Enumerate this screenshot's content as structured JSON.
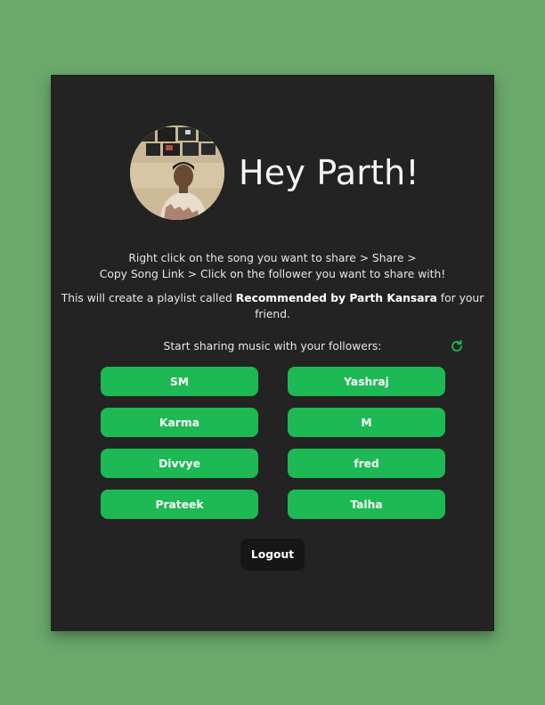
{
  "greeting": "Hey Parth!",
  "avatar_alt": "Profile photo",
  "instructions": {
    "line1a": "Right click on the song you want to share > Share >",
    "line1b": "Copy Song Link > Click on the follower you want to share with!",
    "line2_prefix": "This will create a playlist called ",
    "playlist_name": "Recommended by Parth Kansara",
    "line2_suffix": " for your friend."
  },
  "followers_heading": "Start sharing music with your followers:",
  "followers": [
    {
      "label": "SM"
    },
    {
      "label": "Yashraj"
    },
    {
      "label": "Karma"
    },
    {
      "label": "M"
    },
    {
      "label": "Divvye"
    },
    {
      "label": "fred"
    },
    {
      "label": "Prateek"
    },
    {
      "label": "Talha"
    }
  ],
  "logout_label": "Logout",
  "icons": {
    "refresh": "refresh-icon"
  },
  "colors": {
    "page_background": "#6aa86c",
    "card_background": "#232323",
    "accent_green": "#1db954",
    "logout_background": "#161616"
  }
}
